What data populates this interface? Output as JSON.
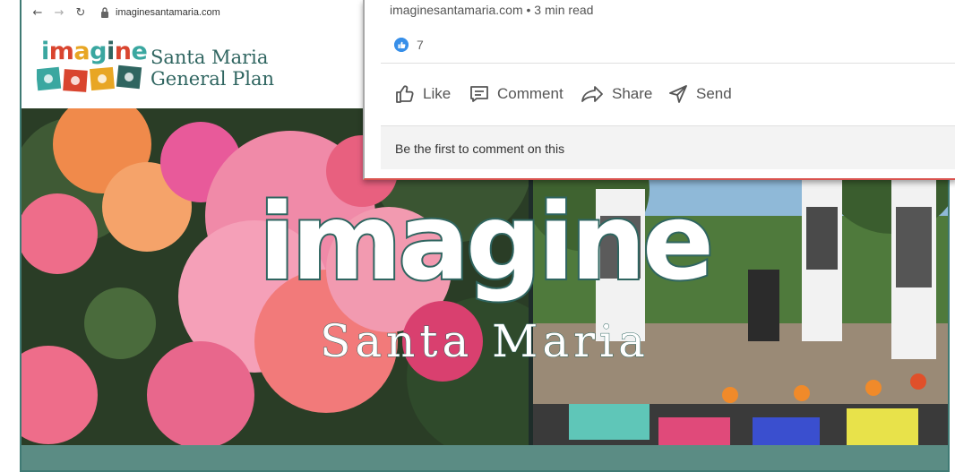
{
  "browser": {
    "back_icon": "arrow-left-icon",
    "forward_icon": "arrow-right-icon",
    "reload_icon": "reload-icon",
    "lock_icon": "lock-icon",
    "url": "imaginesantamaria.com"
  },
  "site": {
    "logo_word": "imagine",
    "logo_colors": [
      "#3aa7a0",
      "#d9452f",
      "#e8a624",
      "#2f6560"
    ],
    "title_line1": "Santa Maria",
    "title_line2": "General Plan",
    "accent": "#2f6560"
  },
  "hero": {
    "title": "imagine",
    "subtitle": "Santa Maria"
  },
  "linkedin": {
    "meta": "imaginesantamaria.com • 3 min read",
    "reaction_icon": "like-reaction-icon",
    "reaction_count": "7",
    "actions": [
      {
        "label": "Like",
        "icon": "thumbs-up-icon"
      },
      {
        "label": "Comment",
        "icon": "comment-icon"
      },
      {
        "label": "Share",
        "icon": "share-icon"
      },
      {
        "label": "Send",
        "icon": "send-icon"
      }
    ],
    "first_comment_prompt": "Be the first to comment on this"
  }
}
